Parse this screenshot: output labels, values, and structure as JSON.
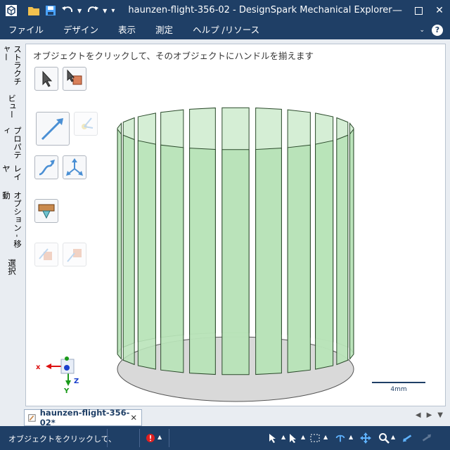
{
  "app": {
    "title": "haunzen-flight-356-02 - DesignSpark Mechanical Explorer"
  },
  "menu": {
    "items": [
      "ファイル",
      "デザイン",
      "表示",
      "測定",
      "ヘルプ /リソース"
    ]
  },
  "side_tabs": [
    "ストラクチャー",
    "ビュー",
    "プロパティ",
    "レイヤ",
    "オプション - 移動",
    "選択"
  ],
  "viewport": {
    "hint": "オブジェクトをクリックして、そのオブジェクトにハンドルを揃えます",
    "scale_label": "4mm",
    "axis_x": "x",
    "axis_y": "Y",
    "axis_z": "Z"
  },
  "document_tab": {
    "label": "haunzen-flight-356-02*"
  },
  "status": {
    "text": "オブジェクトをクリックして、"
  },
  "colors": {
    "chrome": "#1f3f66",
    "model_fill": "#b9e3b9",
    "model_stroke": "#2b4a2b",
    "base_fill": "#d9d9d9"
  }
}
